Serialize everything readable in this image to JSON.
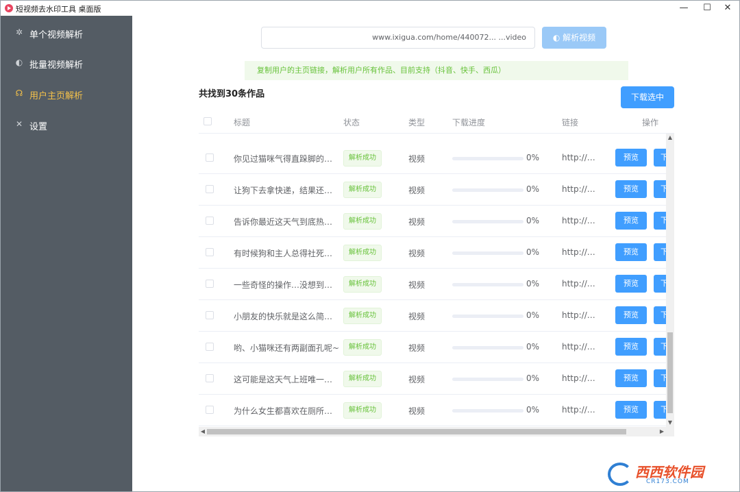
{
  "window": {
    "title": "短视频去水印工具 桌面版",
    "min": "—",
    "max": "☐",
    "close": "✕"
  },
  "sidebar": {
    "items": [
      {
        "label": "单个视频解析",
        "icon": "gear-icon",
        "glyph": "✲",
        "active": false
      },
      {
        "label": "批量视频解析",
        "icon": "half-circle-icon",
        "glyph": "◐",
        "active": false
      },
      {
        "label": "用户主页解析",
        "icon": "headset-icon",
        "glyph": "☊",
        "active": true
      },
      {
        "label": "设置",
        "icon": "tools-icon",
        "glyph": "✕",
        "active": false
      }
    ]
  },
  "search": {
    "value": "www.ixigua.com/home/440072...          ...video",
    "parse_label": "◐ 解析视频"
  },
  "tip": "复制用户的主页链接，解析用户所有作品、目前支持（抖音、快手、西瓜）",
  "result": {
    "found_text": "共找到30条作品",
    "download_selected_label": "下载选中"
  },
  "table": {
    "headers": {
      "title": "标题",
      "status": "状态",
      "type": "类型",
      "progress": "下载进度",
      "link": "链接",
      "action": "操作"
    },
    "rows": [
      {
        "title": "你见过猫咪气得直跺脚的…",
        "status": "解析成功",
        "type": "视频",
        "progress": 0,
        "progress_text": "0%",
        "link": "http://…",
        "preview": "预览",
        "download": "下"
      },
      {
        "title": "让狗下去拿快递，结果还…",
        "status": "解析成功",
        "type": "视频",
        "progress": 0,
        "progress_text": "0%",
        "link": "http://…",
        "preview": "预览",
        "download": "下"
      },
      {
        "title": "告诉你最近这天气到底热…",
        "status": "解析成功",
        "type": "视频",
        "progress": 0,
        "progress_text": "0%",
        "link": "http://…",
        "preview": "预览",
        "download": "下"
      },
      {
        "title": "有时候狗和主人总得社死…",
        "status": "解析成功",
        "type": "视频",
        "progress": 0,
        "progress_text": "0%",
        "link": "http://…",
        "preview": "预览",
        "download": "下"
      },
      {
        "title": "一些奇怪的操作…没想到…",
        "status": "解析成功",
        "type": "视频",
        "progress": 0,
        "progress_text": "0%",
        "link": "http://…",
        "preview": "预览",
        "download": "下"
      },
      {
        "title": "小朋友的快乐就是这么简…",
        "status": "解析成功",
        "type": "视频",
        "progress": 0,
        "progress_text": "0%",
        "link": "http://…",
        "preview": "预览",
        "download": "下"
      },
      {
        "title": "哟、小猫咪还有两副面孔呢~",
        "status": "解析成功",
        "type": "视频",
        "progress": 0,
        "progress_text": "0%",
        "link": "http://…",
        "preview": "预览",
        "download": "下"
      },
      {
        "title": "这可能是这天气上班唯一…",
        "status": "解析成功",
        "type": "视频",
        "progress": 0,
        "progress_text": "0%",
        "link": "http://…",
        "preview": "预览",
        "download": "下"
      },
      {
        "title": "为什么女生都喜欢在厕所…",
        "status": "解析成功",
        "type": "视频",
        "progress": 0,
        "progress_text": "0%",
        "link": "http://…",
        "preview": "预览",
        "download": "下"
      }
    ]
  },
  "watermark": {
    "main": "西西软件园",
    "sub": "CR173.COM"
  },
  "colors": {
    "sidebar_bg": "#545c64",
    "active_nav": "#f5c24a",
    "primary": "#409eff",
    "success": "#67c23a"
  }
}
